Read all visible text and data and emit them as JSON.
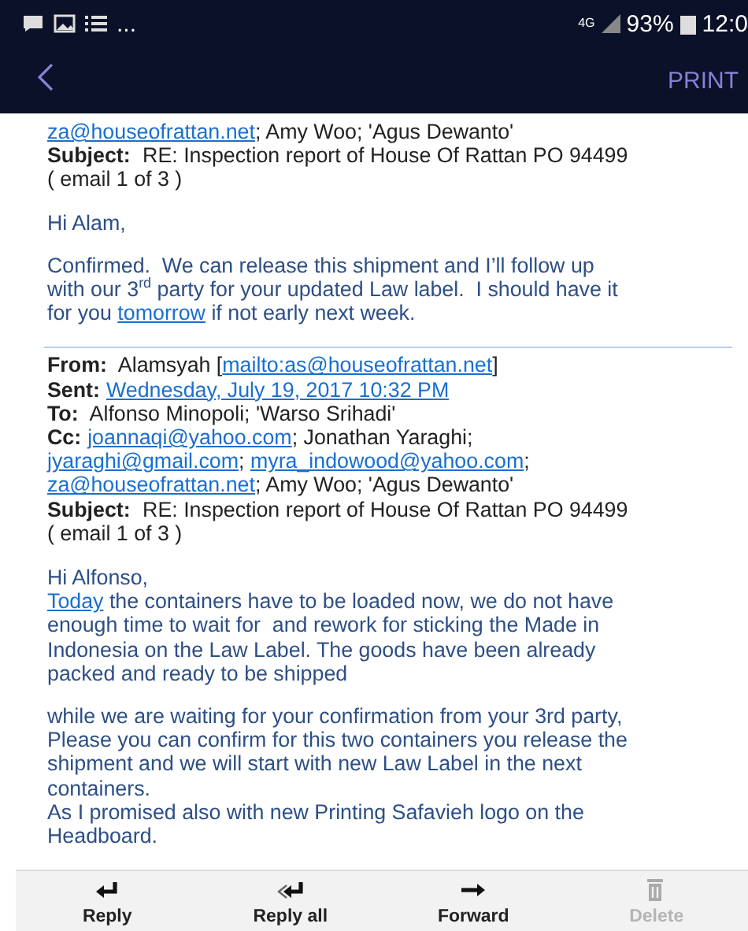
{
  "status_bar": {
    "overflow": "...",
    "network": "4G",
    "battery": "93%",
    "time": "12:0"
  },
  "app_bar": {
    "action": "PRINT"
  },
  "messages": [
    {
      "header": [
        {
          "lines": [
            [
              {
                "kind": "link",
                "text": "za@houseofrattan.net"
              },
              {
                "kind": "text",
                "text": "; Amy Woo; 'Agus Dewanto'"
              }
            ]
          ]
        },
        {
          "label": "Subject:",
          "lines": [
            [
              {
                "kind": "text",
                "text": " RE: Inspection report of House Of Rattan PO 94499"
              }
            ],
            [
              {
                "kind": "text",
                "text": "( email 1 of 3 )"
              }
            ]
          ]
        }
      ],
      "body": [
        [
          [
            {
              "kind": "text",
              "text": "Hi Alam,"
            }
          ]
        ],
        [
          [
            {
              "kind": "text",
              "text": "Confirmed.  We can release this shipment and I’ll follow up"
            }
          ],
          [
            {
              "kind": "text",
              "text": "with our 3"
            },
            {
              "kind": "sup",
              "text": "rd"
            },
            {
              "kind": "text",
              "text": " party for your updated Law label.  I should have it"
            }
          ],
          [
            {
              "kind": "text",
              "text": "for you "
            },
            {
              "kind": "link",
              "text": "tomorrow"
            },
            {
              "kind": "text",
              "text": " if not early next week."
            }
          ]
        ]
      ]
    },
    {
      "header": [
        {
          "label": "From:",
          "lines": [
            [
              {
                "kind": "text",
                "text": " Alamsyah ["
              },
              {
                "kind": "link",
                "text": "mailto:as@houseofrattan.net"
              },
              {
                "kind": "text",
                "text": "]"
              }
            ]
          ]
        },
        {
          "label": "Sent:",
          "lines": [
            [
              {
                "kind": "link",
                "text": "Wednesday, July 19, 2017 10:32 PM"
              }
            ]
          ]
        },
        {
          "label": "To:",
          "lines": [
            [
              {
                "kind": "text",
                "text": " Alfonso Minopoli; 'Warso Srihadi'"
              }
            ]
          ]
        },
        {
          "label": "Cc:",
          "lines": [
            [
              {
                "kind": "link",
                "text": "joannaqi@yahoo.com"
              },
              {
                "kind": "text",
                "text": "; Jonathan Yaraghi;"
              }
            ],
            [
              {
                "kind": "link",
                "text": "jyaraghi@gmail.com"
              },
              {
                "kind": "text",
                "text": "; "
              },
              {
                "kind": "link",
                "text": "myra_indowood@yahoo.com"
              },
              {
                "kind": "text",
                "text": ";"
              }
            ],
            [
              {
                "kind": "link",
                "text": "za@houseofrattan.net"
              },
              {
                "kind": "text",
                "text": "; Amy Woo; 'Agus Dewanto'"
              }
            ]
          ]
        },
        {
          "label": "Subject:",
          "lines": [
            [
              {
                "kind": "text",
                "text": " RE: Inspection report of House Of Rattan PO 94499"
              }
            ],
            [
              {
                "kind": "text",
                "text": "( email 1 of 3 )"
              }
            ]
          ]
        }
      ],
      "body": [
        [
          [
            {
              "kind": "text",
              "text": "Hi Alfonso,"
            }
          ],
          [
            {
              "kind": "link",
              "text": "Today"
            },
            {
              "kind": "text",
              "text": " the containers have to be loaded now, we do not have"
            }
          ],
          [
            {
              "kind": "text",
              "text": "enough time to wait for  and rework for sticking the Made in"
            }
          ],
          [
            {
              "kind": "text",
              "text": "Indonesia on the Law Label. The goods have been already"
            }
          ],
          [
            {
              "kind": "text",
              "text": "packed and ready to be shipped"
            }
          ]
        ],
        [
          [
            {
              "kind": "text",
              "text": "while we are waiting for your confirmation from your 3rd party,"
            }
          ],
          [
            {
              "kind": "text",
              "text": "Please you can confirm for this two containers you release the"
            }
          ],
          [
            {
              "kind": "text",
              "text": "shipment and we will start with new Law Label in the next"
            }
          ],
          [
            {
              "kind": "text",
              "text": "containers."
            }
          ],
          [
            {
              "kind": "text",
              "text": "As I promised also with new Printing Safavieh logo on the"
            }
          ],
          [
            {
              "kind": "text",
              "text": "Headboard."
            }
          ]
        ]
      ]
    }
  ],
  "toolbar": [
    {
      "kind": "reply",
      "label": "Reply",
      "disabled": false
    },
    {
      "kind": "reply_all",
      "label": "Reply all",
      "disabled": false
    },
    {
      "kind": "forward",
      "label": "Forward",
      "disabled": false
    },
    {
      "kind": "delete",
      "label": "Delete",
      "disabled": true
    }
  ]
}
